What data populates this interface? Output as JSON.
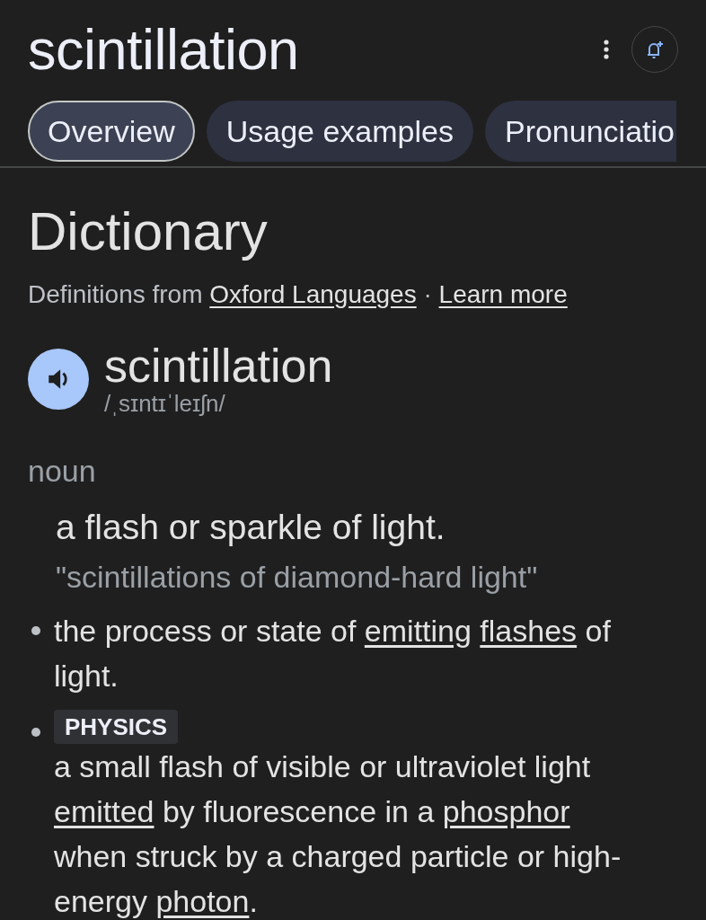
{
  "header": {
    "title": "scintillation"
  },
  "tabs": [
    {
      "label": "Overview",
      "selected": true
    },
    {
      "label": "Usage examples",
      "selected": false
    },
    {
      "label": "Pronunciatio",
      "selected": false
    }
  ],
  "dictionary": {
    "heading": "Dictionary",
    "source": [
      {
        "text": "Definitions from ",
        "link": false
      },
      {
        "text": "Oxford Languages",
        "link": true
      },
      {
        "text": " · ",
        "link": false
      },
      {
        "text": "Learn more",
        "link": true
      }
    ],
    "word": "scintillation",
    "phonetic": "/ˌsɪntɪˈleɪʃn/",
    "part_of_speech": "noun",
    "definition": "a flash or sparkle of light.",
    "example": "\"scintillations of diamond-hard light\"",
    "senses": [
      {
        "segments": [
          {
            "text": "the process or state of ",
            "link": false
          },
          {
            "text": "emitting ",
            "link": true
          },
          {
            "text": "flashes",
            "link": true
          },
          {
            "text": " of light.",
            "link": false
          }
        ]
      },
      {
        "label": "PHYSICS",
        "segments": [
          {
            "text": "a small flash of visible or ultraviolet light ",
            "link": false
          },
          {
            "text": "emitted",
            "link": true
          },
          {
            "text": " by fluorescence in a ",
            "link": false
          },
          {
            "text": "phosphor",
            "link": true
          },
          {
            "text": " when struck by a charged particle or high-energy ",
            "link": false
          },
          {
            "text": "photon",
            "link": true
          },
          {
            "text": ".",
            "link": false
          }
        ]
      }
    ]
  }
}
